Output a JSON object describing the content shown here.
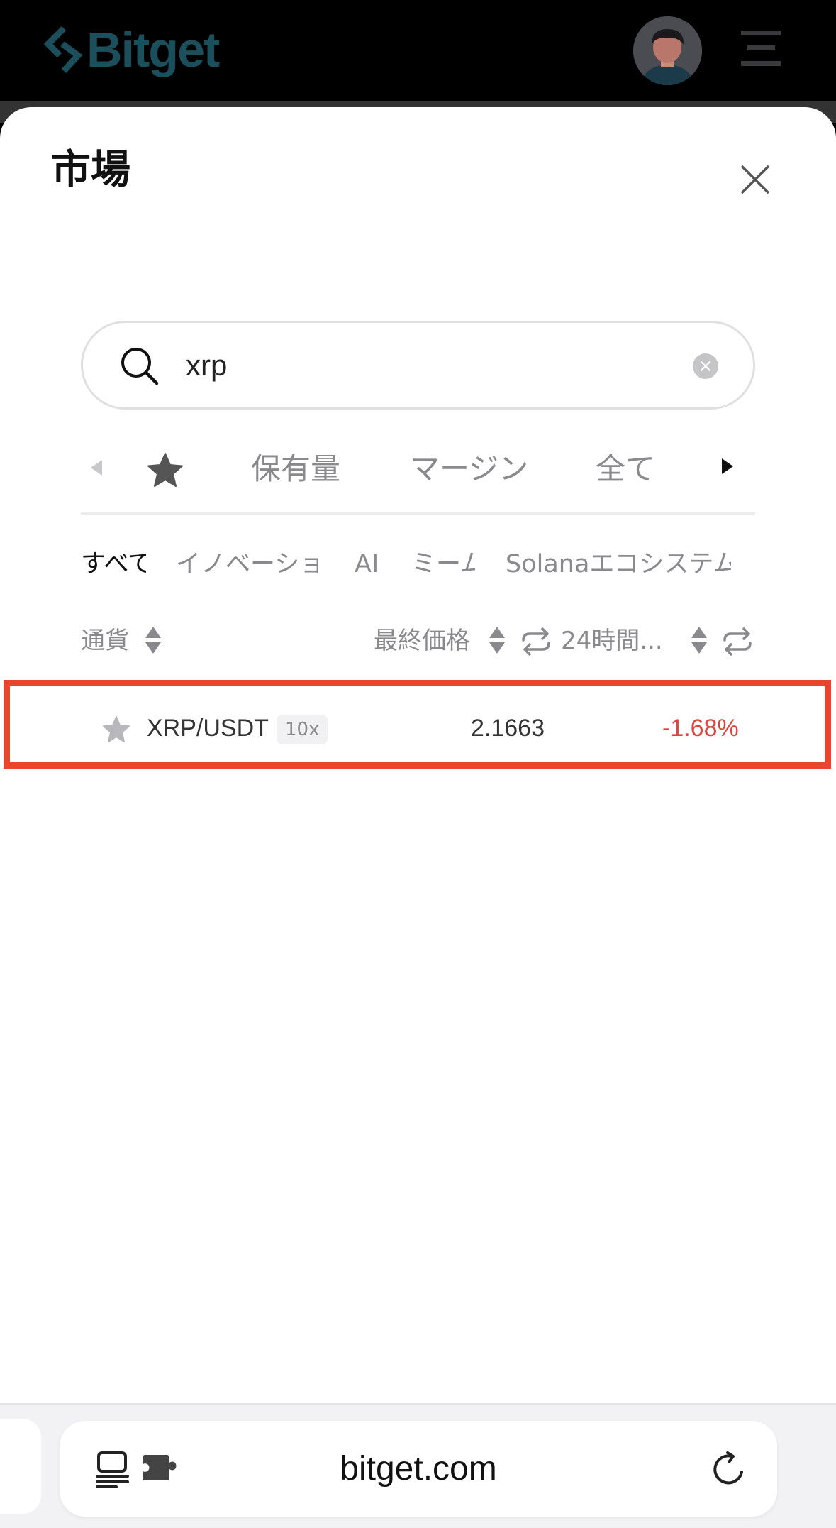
{
  "header": {
    "logo_text": "Bitget",
    "brand_color": "#1b4f5c"
  },
  "sheet": {
    "title": "市場",
    "close_icon": "close-icon"
  },
  "search": {
    "value": "xrp",
    "icon": "search-icon"
  },
  "tabs": [
    "保有量",
    "マージン",
    "全て"
  ],
  "subtabs": [
    "すべて",
    "イノベーション",
    "AI",
    "ミーム",
    "Solanaエコシステム"
  ],
  "table": {
    "columns": {
      "currency": "通貨",
      "last_price": "最終価格",
      "change_24h": "24時間..."
    },
    "rows": [
      {
        "pair": "XRP/USDT",
        "leverage": "10x",
        "price": "2.1663",
        "change": "-1.68%",
        "change_color": "#d9473f"
      }
    ]
  },
  "browser": {
    "url": "bitget.com"
  }
}
